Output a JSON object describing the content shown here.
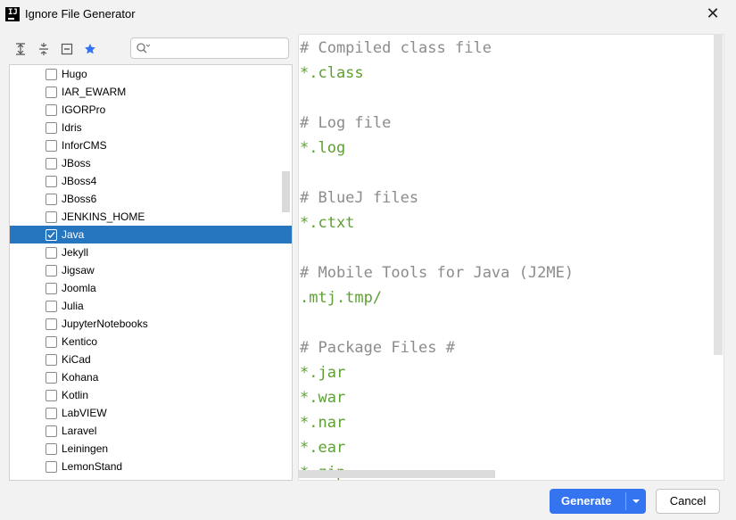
{
  "window": {
    "title": "Ignore File Generator",
    "logo_text": "IJ",
    "close_glyph": "✕"
  },
  "toolbar": {
    "icons": [
      "expand-all-icon",
      "collapse-all-icon",
      "uncheck-all-icon",
      "favorite-star-icon"
    ],
    "search_value": ""
  },
  "templates": [
    {
      "label": "Hugo",
      "checked": false
    },
    {
      "label": "IAR_EWARM",
      "checked": false
    },
    {
      "label": "IGORPro",
      "checked": false
    },
    {
      "label": "Idris",
      "checked": false
    },
    {
      "label": "InforCMS",
      "checked": false
    },
    {
      "label": "JBoss",
      "checked": false
    },
    {
      "label": "JBoss4",
      "checked": false
    },
    {
      "label": "JBoss6",
      "checked": false
    },
    {
      "label": "JENKINS_HOME",
      "checked": false
    },
    {
      "label": "Java",
      "checked": true,
      "selected": true
    },
    {
      "label": "Jekyll",
      "checked": false
    },
    {
      "label": "Jigsaw",
      "checked": false
    },
    {
      "label": "Joomla",
      "checked": false
    },
    {
      "label": "Julia",
      "checked": false
    },
    {
      "label": "JupyterNotebooks",
      "checked": false
    },
    {
      "label": "Kentico",
      "checked": false
    },
    {
      "label": "KiCad",
      "checked": false
    },
    {
      "label": "Kohana",
      "checked": false
    },
    {
      "label": "Kotlin",
      "checked": false
    },
    {
      "label": "LabVIEW",
      "checked": false
    },
    {
      "label": "Laravel",
      "checked": false
    },
    {
      "label": "Leiningen",
      "checked": false
    },
    {
      "label": "LemonStand",
      "checked": false
    }
  ],
  "preview_lines": [
    {
      "text": "# Compiled class file",
      "kind": "comment"
    },
    {
      "text": "*.class",
      "kind": "pattern"
    },
    {
      "text": "",
      "kind": "blank"
    },
    {
      "text": "# Log file",
      "kind": "comment"
    },
    {
      "text": "*.log",
      "kind": "pattern"
    },
    {
      "text": "",
      "kind": "blank"
    },
    {
      "text": "# BlueJ files",
      "kind": "comment"
    },
    {
      "text": "*.ctxt",
      "kind": "pattern"
    },
    {
      "text": "",
      "kind": "blank"
    },
    {
      "text": "# Mobile Tools for Java (J2ME)",
      "kind": "comment"
    },
    {
      "text": ".mtj.tmp/",
      "kind": "pattern"
    },
    {
      "text": "",
      "kind": "blank"
    },
    {
      "text": "# Package Files #",
      "kind": "comment"
    },
    {
      "text": "*.jar",
      "kind": "pattern"
    },
    {
      "text": "*.war",
      "kind": "pattern"
    },
    {
      "text": "*.nar",
      "kind": "pattern"
    },
    {
      "text": "*.ear",
      "kind": "pattern"
    },
    {
      "text": "*.zip",
      "kind": "pattern"
    }
  ],
  "buttons": {
    "generate_label": "Generate",
    "cancel_label": "Cancel"
  },
  "colors": {
    "accent": "#3574f0",
    "selection": "#2675bf",
    "comment": "#8c8c8c",
    "pattern": "#5ea034"
  }
}
